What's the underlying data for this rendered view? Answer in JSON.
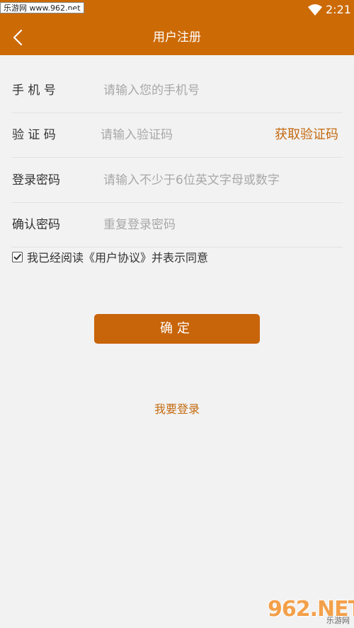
{
  "status_bar": {
    "watermark": "乐游网 www.962.net",
    "time": "2:21",
    "wifi_icon": "wifi-icon"
  },
  "header": {
    "back_icon": "chevron-left-icon",
    "title": "用户注册"
  },
  "form": {
    "phone": {
      "label": "手 机 号",
      "placeholder": "请输入您的手机号",
      "value": ""
    },
    "code": {
      "label": "验 证 码",
      "placeholder": "请输入验证码",
      "value": "",
      "get_code_label": "获取验证码"
    },
    "password": {
      "label": "登录密码",
      "placeholder": "请输入不少于6位英文字母或数字",
      "value": ""
    },
    "confirm_password": {
      "label": "确认密码",
      "placeholder": "重复登录密码",
      "value": ""
    }
  },
  "agreement": {
    "checked": true,
    "text": "我已经阅读《用户协议》并表示同意"
  },
  "confirm_button": "确定",
  "login_link": "我要登录",
  "watermark_bottom": {
    "big": "962.NET",
    "small": "乐游网"
  },
  "colors": {
    "primary": "#cc6a06",
    "accent_text": "#c46a10",
    "background": "#f2f2f2"
  }
}
